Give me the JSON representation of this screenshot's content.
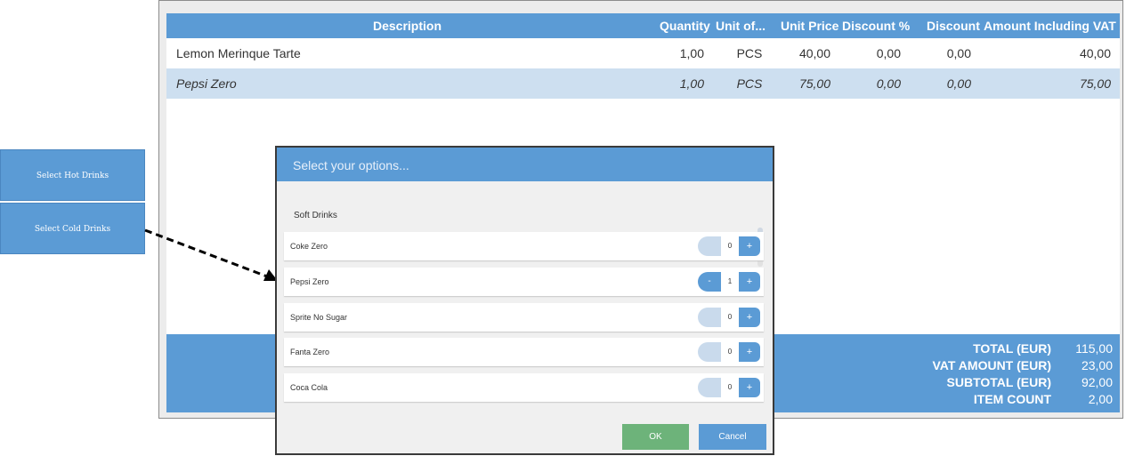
{
  "pos": {
    "headers": {
      "description": "Description",
      "quantity": "Quantity",
      "unit": "Unit of...",
      "unit_price": "Unit Price",
      "discount_pct": "Discount %",
      "discount": "Discount",
      "amount_incl_vat": "Amount Including VAT"
    },
    "lines": [
      {
        "description": "Lemon Merinque Tarte",
        "quantity": "1,00",
        "unit": "PCS",
        "unit_price": "40,00",
        "discount_pct": "0,00",
        "discount": "0,00",
        "amount": "40,00"
      },
      {
        "description": "Pepsi Zero",
        "quantity": "1,00",
        "unit": "PCS",
        "unit_price": "75,00",
        "discount_pct": "0,00",
        "discount": "0,00",
        "amount": "75,00"
      }
    ],
    "totals": [
      {
        "label": "TOTAL (EUR)",
        "value": "115,00"
      },
      {
        "label": "VAT AMOUNT (EUR)",
        "value": "23,00"
      },
      {
        "label": "SUBTOTAL (EUR)",
        "value": "92,00"
      },
      {
        "label": "ITEM COUNT",
        "value": "2,00"
      }
    ]
  },
  "side_buttons": {
    "hot": "Select Hot Drinks",
    "cold": "Select Cold Drinks"
  },
  "dialog": {
    "title": "Select your options...",
    "group": "Soft Drinks",
    "options": [
      {
        "name": "Coke Zero",
        "qty": "0"
      },
      {
        "name": "Pepsi Zero",
        "qty": "1"
      },
      {
        "name": "Sprite No Sugar",
        "qty": "0"
      },
      {
        "name": "Fanta Zero",
        "qty": "0"
      },
      {
        "name": "Coca Cola",
        "qty": "0"
      }
    ],
    "minus_symbol": "-",
    "plus_symbol": "+",
    "ok_label": "OK",
    "cancel_label": "Cancel"
  },
  "colors": {
    "accent": "#5b9bd5",
    "row_highlight": "#cddff0",
    "ok": "#6db37a"
  }
}
